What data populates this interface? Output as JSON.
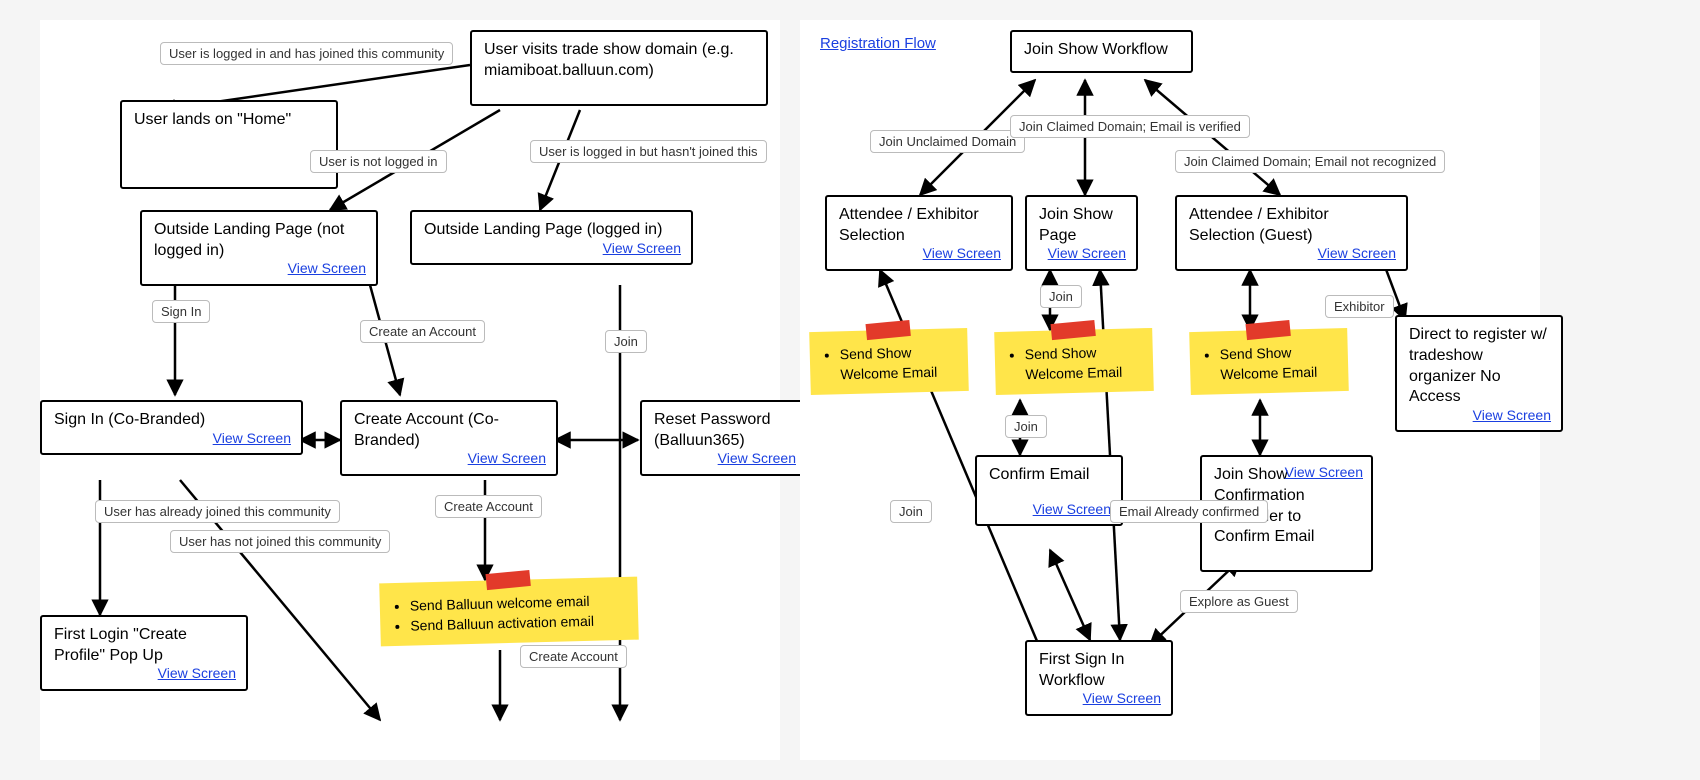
{
  "labels": {
    "viewScreen": "View Screen",
    "registrationFlow": "Registration Flow"
  },
  "left": {
    "nodes": {
      "visit": "User visits trade show domain (e.g. miamiboat.balluun.com)",
      "home": "User lands on \"Home\"",
      "outsideNotLogged": "Outside Landing Page (not logged in)",
      "outsideLogged": "Outside Landing Page (logged in)",
      "signIn": "Sign In (Co-Branded)",
      "createAccount": "Create Account (Co-Branded)",
      "resetPassword": "Reset Password (Balluun365)",
      "firstLogin": "First Login \"Create Profile\" Pop Up"
    },
    "edges": {
      "loggedJoined": "User is logged in and has joined this community",
      "notLogged": "User is not logged in",
      "loggedNotJoined": "User is logged in but hasn't joined this",
      "signIn": "Sign In",
      "createAnAccount": "Create an Account",
      "join": "Join",
      "createAccount": "Create Account",
      "alreadyJoined": "User has already joined this community",
      "notJoined": "User has not joined this community"
    },
    "sticky": {
      "a": "Send Balluun welcome email",
      "b": "Send Balluun activation email"
    }
  },
  "right": {
    "nodes": {
      "joinWorkflow": "Join Show Workflow",
      "attendeeExhibitor": "Attendee / Exhibitor Selection",
      "joinShowPage": "Join Show Page",
      "attendeeExhibitorGuest": "Attendee / Exhibitor Selection (Guest)",
      "directRegister": "Direct to register w/ tradeshow organizer No Access",
      "confirmEmail": "Confirm Email",
      "joinShowConfirm": "Join Show Confirmation Reminder to Confirm Email",
      "firstSignIn": "First Sign In Workflow"
    },
    "edges": {
      "joinUnclaimed": "Join Unclaimed Domain",
      "joinClaimedVerified": "Join Claimed Domain; Email is verified",
      "joinClaimedNot": "Join Claimed Domain; Email not recognized",
      "exhibitor": "Exhibitor",
      "join": "Join",
      "emailConfirmed": "Email Already confirmed",
      "exploreGuest": "Explore as Guest"
    },
    "sticky": "Send Show Welcome Email"
  }
}
